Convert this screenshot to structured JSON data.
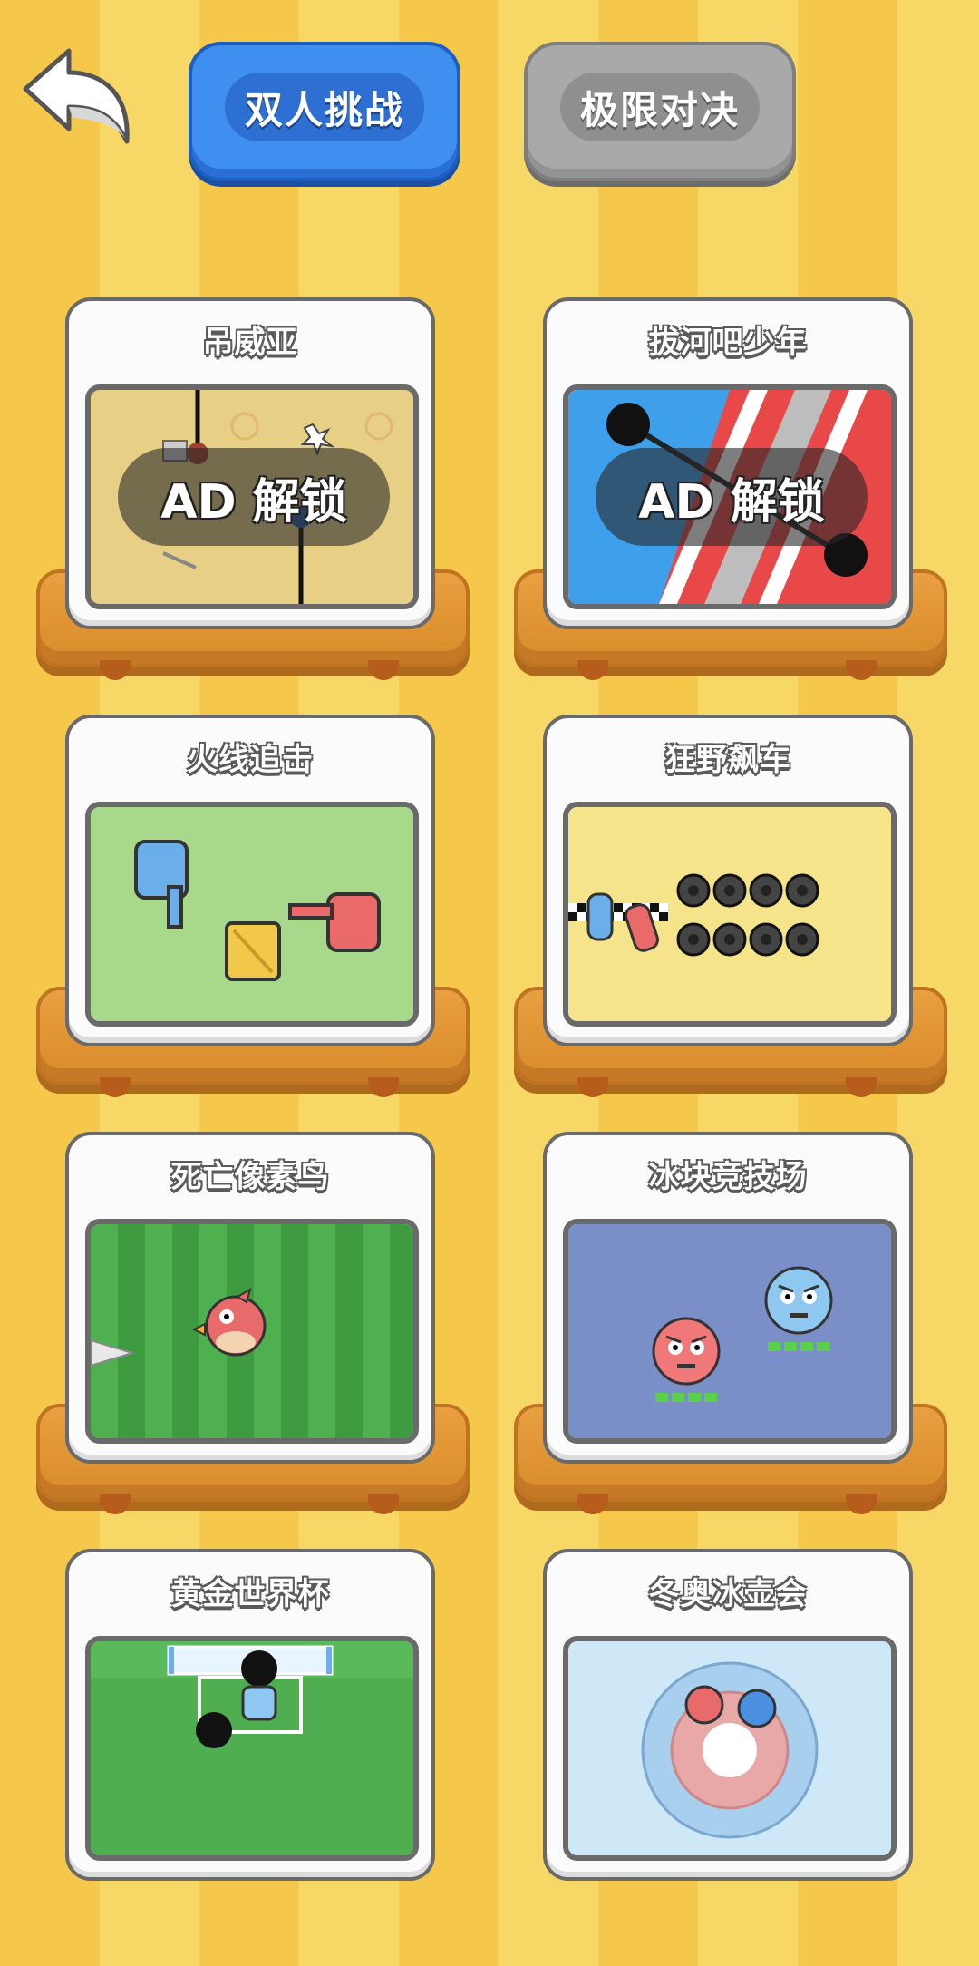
{
  "header": {
    "back_icon": "back-arrow-icon",
    "tabs": [
      {
        "label": "双人挑战",
        "active": true,
        "color": "#3f8ff0"
      },
      {
        "label": "极限对决",
        "active": false,
        "color": "#a9a9a9"
      }
    ]
  },
  "games": [
    {
      "title": "吊威亚",
      "locked": true,
      "ad_label": "AD 解锁"
    },
    {
      "title": "拔河吧少年",
      "locked": true,
      "ad_label": "AD 解锁"
    },
    {
      "title": "火线追击",
      "locked": false
    },
    {
      "title": "狂野飙车",
      "locked": false
    },
    {
      "title": "死亡像素鸟",
      "locked": false
    },
    {
      "title": "冰块竞技场",
      "locked": false
    },
    {
      "title": "黄金世界杯",
      "locked": false
    },
    {
      "title": "冬奥冰壶会",
      "locked": false
    }
  ],
  "colors": {
    "background": "#f5c84c",
    "pedestal": "#e9a040",
    "tab_active": "#3f8ff0",
    "tab_inactive": "#a9a9a9"
  }
}
